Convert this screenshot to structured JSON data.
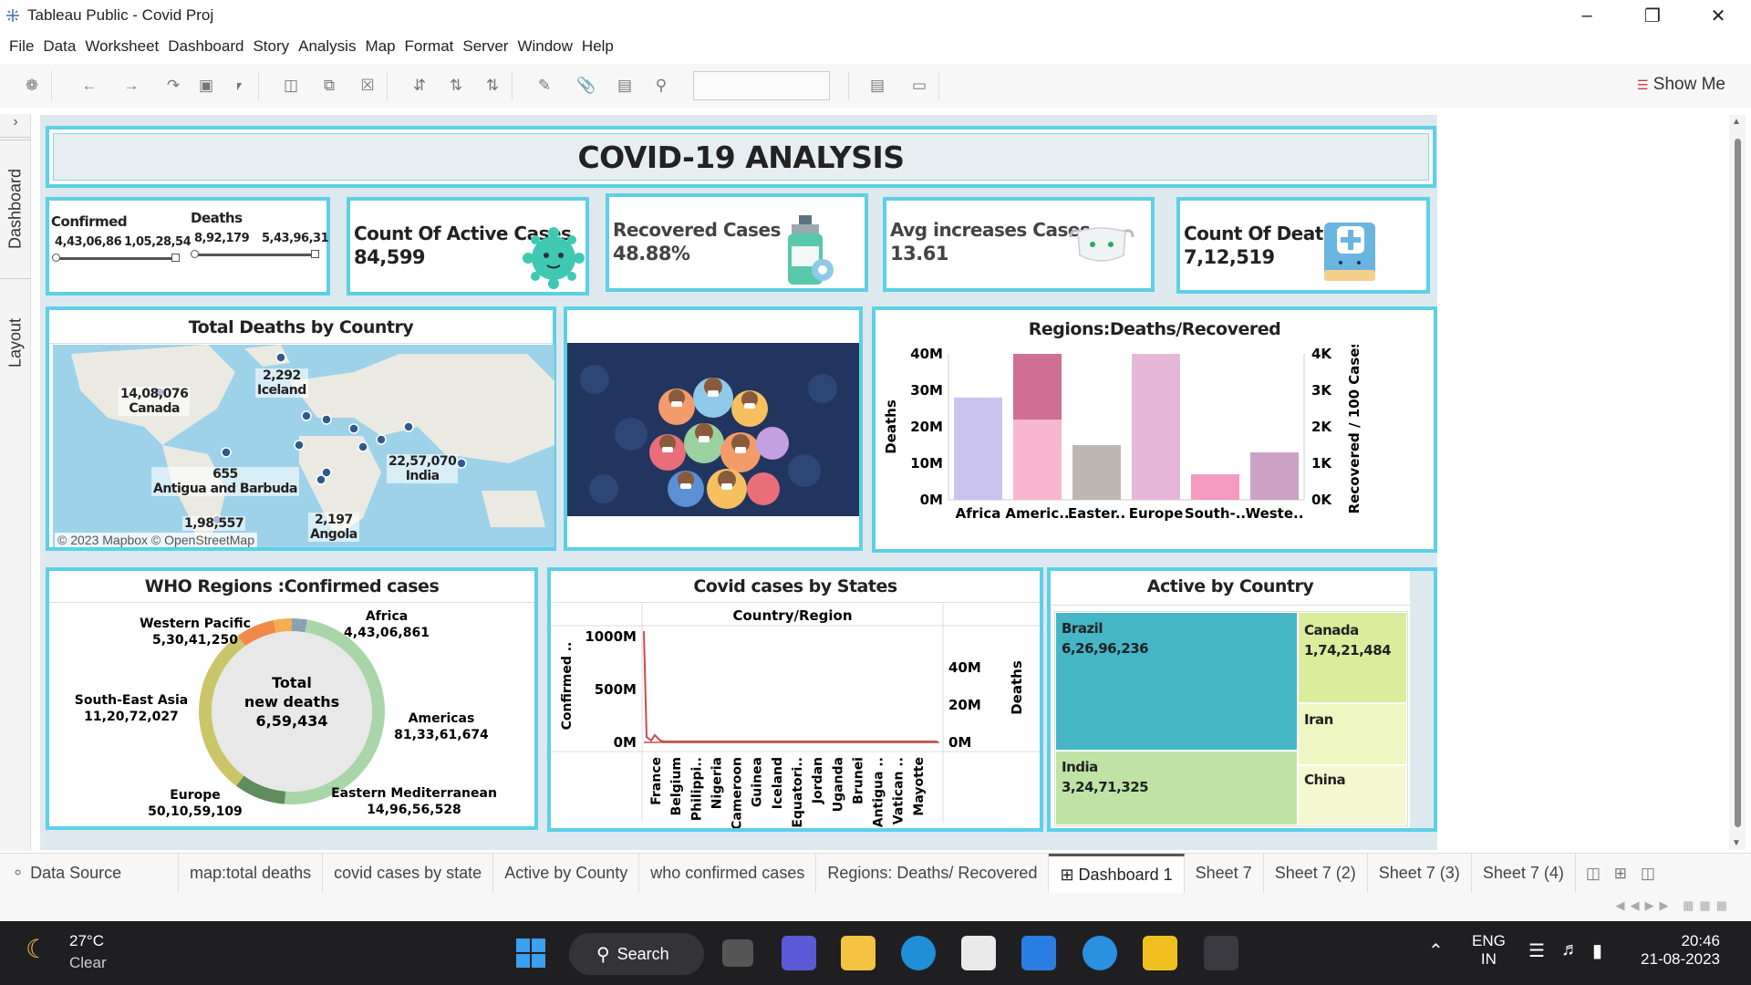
{
  "window": {
    "title": "Tableau Public - Covid Proj"
  },
  "menu": [
    "File",
    "Data",
    "Worksheet",
    "Dashboard",
    "Story",
    "Analysis",
    "Map",
    "Format",
    "Server",
    "Window",
    "Help"
  ],
  "toolbar": {
    "show_me": "Show Me"
  },
  "side_tabs": {
    "dashboard": "Dashboard",
    "layout": "Layout"
  },
  "dashboard": {
    "title": "COVID-19 ANALYSIS",
    "filters": {
      "confirmed_label": "Confirmed",
      "confirmed_min": "4,43,06,86",
      "confirmed_max": "1,05,28,54",
      "deaths_label": "Deaths",
      "deaths_min": "8,92,179",
      "deaths_max": "5,43,96,31"
    },
    "kpis": [
      {
        "label": "Count Of Active Cases",
        "value": "84,599"
      },
      {
        "label": "Recovered Cases",
        "value": "48.88%"
      },
      {
        "label": "Avg increases Cases",
        "value": "13.61"
      },
      {
        "label": "Count Of Deaths",
        "value": "7,12,519"
      }
    ],
    "map": {
      "title": "Total Deaths by Country",
      "attribution": "© 2023 Mapbox © OpenStreetMap",
      "labels": [
        {
          "value": "14,08,076",
          "country": "Canada"
        },
        {
          "value": "2,292",
          "country": "Iceland"
        },
        {
          "value": "655",
          "country": "Antigua and Barbuda"
        },
        {
          "value": "22,57,070",
          "country": "India"
        },
        {
          "value": "1,98,557",
          "country": ""
        },
        {
          "value": "2,197",
          "country": "Angola"
        }
      ]
    },
    "regions_chart": {
      "title": "Regions:Deaths/Recovered"
    },
    "donut": {
      "title": "WHO Regions :Confirmed cases",
      "center_label_1": "Total",
      "center_label_2": "new deaths",
      "center_value": "6,59,434"
    },
    "states_chart": {
      "title": "Covid cases by States",
      "header": "Country/Region"
    },
    "treemap": {
      "title": "Active by Country",
      "cells": [
        {
          "name": "Brazil",
          "value": "6,26,96,236"
        },
        {
          "name": "Canada",
          "value": "1,74,21,484"
        },
        {
          "name": "Iran",
          "value": ""
        },
        {
          "name": "India",
          "value": "3,24,71,325"
        },
        {
          "name": "China",
          "value": ""
        }
      ]
    }
  },
  "chart_data": [
    {
      "type": "bar",
      "title": "Regions:Deaths/Recovered",
      "categories": [
        "Africa",
        "Americ..",
        "Easter..",
        "Europe",
        "South-..",
        "Weste.."
      ],
      "ylabel": "Deaths",
      "y2label": "Recovered / 100 Cases",
      "y_ticks": [
        "0M",
        "10M",
        "20M",
        "30M",
        "40M"
      ],
      "y2_ticks": [
        "0K",
        "1K",
        "2K",
        "3K",
        "4K"
      ],
      "ylim": [
        0,
        40
      ],
      "series": [
        {
          "values": [
            28,
            22,
            15,
            40,
            7,
            13
          ]
        },
        {
          "values": [
            0,
            18,
            0,
            0,
            0,
            0
          ]
        }
      ]
    },
    {
      "type": "pie",
      "title": "WHO Regions :Confirmed cases",
      "categories": [
        "Africa",
        "Americas",
        "Eastern Mediterranean",
        "Europe",
        "South-East Asia",
        "Western Pacific"
      ],
      "labels": [
        "4,43,06,861",
        "81,33,61,674",
        "14,96,56,528",
        "50,10,59,109",
        "11,20,72,027",
        "5,30,41,250"
      ],
      "values": [
        44306861,
        813361674,
        149656528,
        501059109,
        112072027,
        53041250
      ],
      "colors": [
        "#8aa0b4",
        "#a9d6a8",
        "#5f8d5c",
        "#cbc56a",
        "#f08a4b",
        "#f4ad4f"
      ]
    },
    {
      "type": "line",
      "title": "Covid cases by States",
      "ylabel": "Confirmed ..",
      "y2label": "Deaths",
      "y_ticks": [
        "0M",
        "500M",
        "1000M"
      ],
      "y2_ticks": [
        "0M",
        "20M",
        "40M"
      ],
      "categories": [
        "France",
        "Belgium",
        "Philippi..",
        "Nigeria",
        "Cameroon",
        "Guinea",
        "Iceland",
        "Equatori..",
        "Jordan",
        "Uganda",
        "Brunei",
        "Antigua ..",
        "Vatican ..",
        "Mayotte"
      ],
      "ylim": [
        0,
        1000
      ]
    }
  ],
  "sheet_tabs": [
    "Data Source",
    "map:total deaths",
    "covid cases by state",
    "Active by County",
    "who confirmed cases",
    "Regions: Deaths/ Recovered",
    "Dashboard 1",
    "Sheet 7",
    "Sheet 7 (2)",
    "Sheet 7 (3)",
    "Sheet 7 (4)"
  ],
  "taskbar": {
    "weather_temp": "27°C",
    "weather_desc": "Clear",
    "search": "Search",
    "lang_1": "ENG",
    "lang_2": "IN",
    "time": "20:46",
    "date": "21-08-2023"
  }
}
